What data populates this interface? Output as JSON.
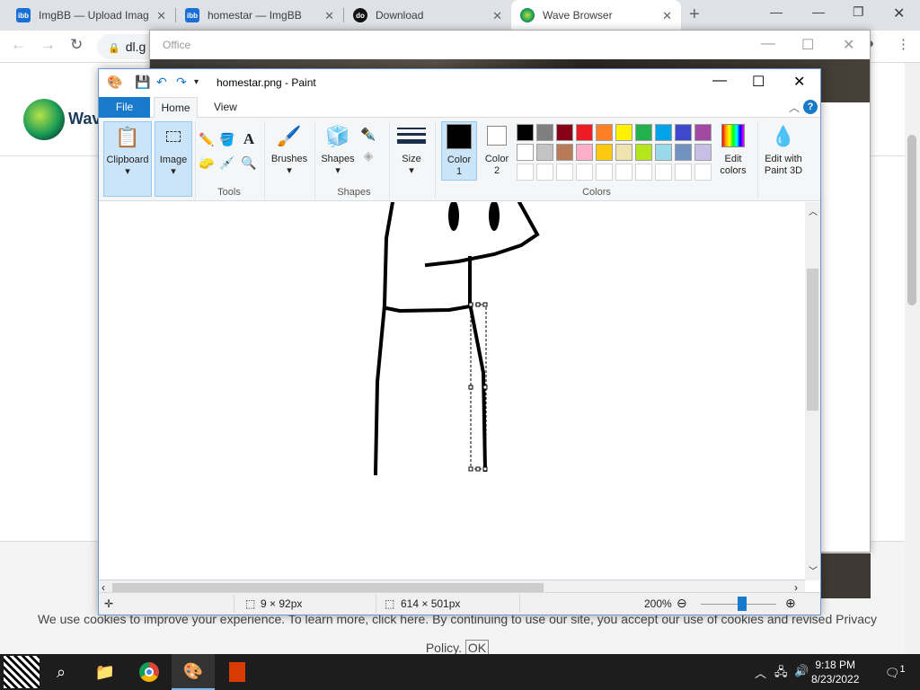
{
  "browser": {
    "tabs": [
      {
        "title": "ImgBB — Upload Imag",
        "favicon": "ibb"
      },
      {
        "title": "homestar — ImgBB",
        "favicon": "ibb"
      },
      {
        "title": "Download",
        "favicon": "dot"
      },
      {
        "title": "Wave Browser",
        "favicon": "wave"
      }
    ],
    "new_tab": "+",
    "address": "dl.g"
  },
  "site": {
    "logo_text": "Wav",
    "cookie_text": "We use cookies to improve your experience. To learn more, click here. By continuing to use our site, you accept our use of cookies and revised Privacy Policy.",
    "cookie_ok": "OK"
  },
  "office": {
    "title": "Office"
  },
  "paint": {
    "title": "homestar.png - Paint",
    "tabs": {
      "file": "File",
      "home": "Home",
      "view": "View"
    },
    "groups": {
      "clipboard": "Clipboard",
      "image": "Image",
      "tools": "Tools",
      "brushes": "Brushes",
      "shapes_btn": "Shapes",
      "shapes": "Shapes",
      "size": "Size",
      "color1_l1": "Color",
      "color1_l2": "1",
      "color2_l1": "Color",
      "color2_l2": "2",
      "colors": "Colors",
      "edit_colors_l1": "Edit",
      "edit_colors_l2": "colors",
      "paint3d_l1": "Edit with",
      "paint3d_l2": "Paint 3D"
    },
    "palette_row1": [
      "#000000",
      "#7f7f7f",
      "#880015",
      "#ed1c24",
      "#ff7f27",
      "#fff200",
      "#22b14c",
      "#00a2e8",
      "#3f48cc",
      "#a349a4"
    ],
    "palette_row2": [
      "#ffffff",
      "#c3c3c3",
      "#b97a57",
      "#ffaec9",
      "#ffc90e",
      "#efe4b0",
      "#b5e61d",
      "#99d9ea",
      "#7092be",
      "#c8bfe7"
    ],
    "color1": "#000000",
    "color2": "#ffffff",
    "status": {
      "selection_size": "9 × 92px",
      "image_size": "614 × 501px",
      "zoom": "200%"
    }
  },
  "taskbar": {
    "time": "9:18 PM",
    "date": "8/23/2022",
    "notification_count": "1"
  }
}
